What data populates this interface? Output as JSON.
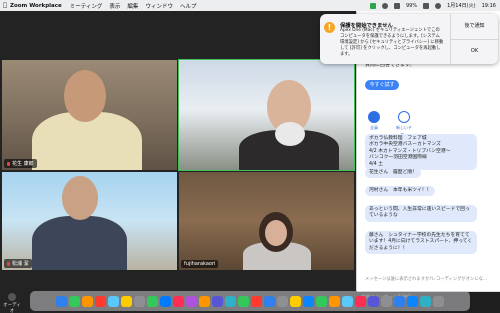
{
  "menubar": {
    "app_name": "Zoom Workplace",
    "items": [
      "ミーティング",
      "表示",
      "編集",
      "ウィンドウ",
      "ヘルプ"
    ],
    "battery": "99%",
    "datetime": "1月14日(火)",
    "time": "19:16"
  },
  "participants": [
    {
      "name": "花生 康郎",
      "muted": true
    },
    {
      "name": "",
      "muted": false
    },
    {
      "name": "松浦 潔",
      "muted": true
    },
    {
      "name": "fujiharakaori",
      "muted": false
    }
  ],
  "panel": {
    "top_text": "質問に回答できます。",
    "cta": "今すぐ試す",
    "apps": [
      {
        "label": "全員"
      },
      {
        "label": "新しいチャ..."
      }
    ],
    "messages": [
      "ボカラ仏教料理　フェア城\nボカラ中央空港バスーカトマンズ\n4/2 木カトマンズ・トリブバン空港～\nバンコク一羽田空港国際線\n4/4 土",
      "花生さん　履歴ど順！",
      "河村さん　本年も米ツイ！！",
      "あっという間、入生非常に速いスピードで回っているような",
      "藤さん　シュタイナー学校の先生たちを育てています！4月に向けてラストスパート、押ってくださるように！！"
    ],
    "notice": "メッセージは誰に表示されますか?レコーディングがオンにな...",
    "input_placeholder": "全員にメッセージを送信"
  },
  "notification": {
    "title": "保護を開始できません",
    "body": "Apex One (Mac) セキュリティエージェントでこのコンピュータを保護できるようにします。[システム環境設定] から [セキュリティとプライバシー] に移動して [許可] をクリックし、コンピュータを再起動します。",
    "btn_later": "後で通知",
    "btn_ok": "OK"
  },
  "audio_label": "オーディオ",
  "dock_colors": [
    "#2f80ed",
    "#34c759",
    "#ff9500",
    "#ff3b30",
    "#5ac8fa",
    "#ffcc00",
    "#8e8e93",
    "#34c759",
    "#007aff",
    "#ff2d55",
    "#af52de",
    "#ff9500",
    "#5856d6",
    "#30b0c7",
    "#34c759",
    "#ff3b30",
    "#2f80ed",
    "#8e8e93",
    "#ffcc00",
    "#0a84ff",
    "#34c759",
    "#ff9500",
    "#5ac8fa",
    "#ff2d55",
    "#5856d6",
    "#8e8e93",
    "#2f80ed",
    "#0a84ff",
    "#30b0c7",
    "#8e8e93"
  ]
}
